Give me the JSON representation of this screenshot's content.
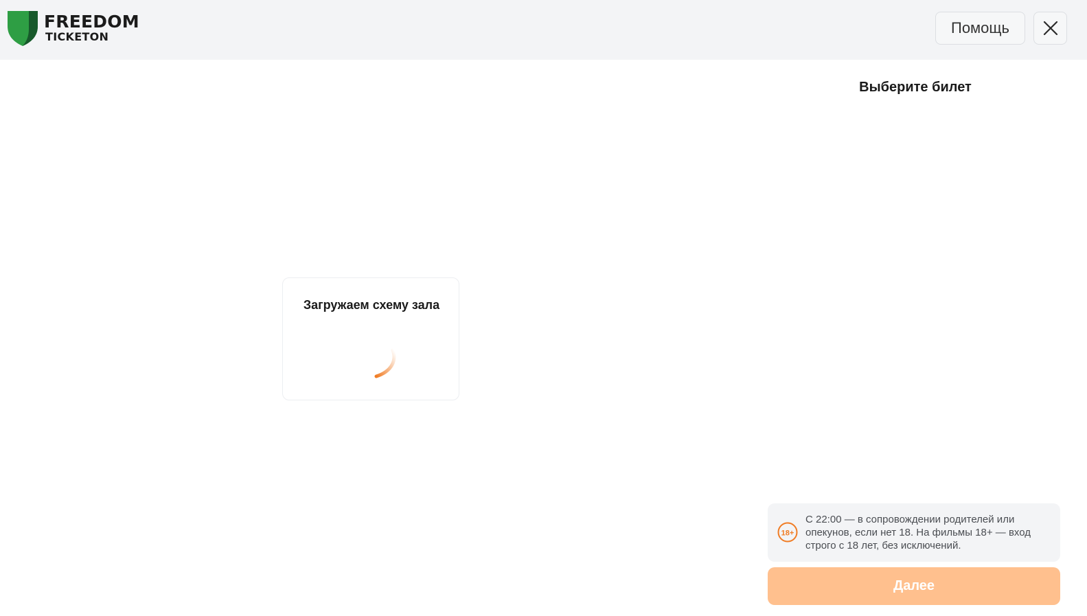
{
  "header": {
    "logo_line1": "FREEDOM",
    "logo_line2": "TICKETON",
    "help_label": "Помощь"
  },
  "sidebar": {
    "title": "Выберите билет"
  },
  "loader": {
    "text": "Загружаем схему зала"
  },
  "notice": {
    "badge": "18+",
    "text": "С 22:00 — в сопровождении родителей или опекунов, если нет 18. На фильмы 18+ — вход строго с 18 лет, без исключений."
  },
  "footer": {
    "next_label": "Далее"
  },
  "colors": {
    "brand_green": "#2e9e44",
    "brand_dark_green": "#17592b",
    "accent_orange": "#f07c24",
    "next_button_disabled": "#ffc08e",
    "header_bg": "#f3f4f6"
  },
  "icons": {
    "logo": "shield-logo-icon",
    "close": "close-icon",
    "spinner": "loading-spinner-icon",
    "age": "age-restriction-icon"
  }
}
